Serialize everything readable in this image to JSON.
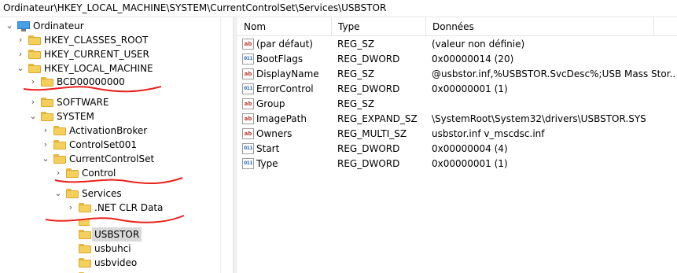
{
  "address_bar": {
    "path": "Ordinateur\\HKEY_LOCAL_MACHINE\\SYSTEM\\CurrentControlSet\\Services\\USBSTOR"
  },
  "tree": {
    "root": "Ordinateur",
    "nodes": [
      {
        "label": "HKEY_CLASSES_ROOT",
        "chevron": "›"
      },
      {
        "label": "HKEY_CURRENT_USER",
        "chevron": "›"
      },
      {
        "label": "HKEY_LOCAL_MACHINE",
        "chevron": "⌄"
      },
      {
        "label": "BCD00000000",
        "chevron": "›"
      },
      {
        "label": "SOFTWARE",
        "chevron": "›"
      },
      {
        "label": "SYSTEM",
        "chevron": "⌄"
      },
      {
        "label": "ActivationBroker",
        "chevron": "›"
      },
      {
        "label": "ControlSet001",
        "chevron": "›"
      },
      {
        "label": "CurrentControlSet",
        "chevron": "⌄"
      },
      {
        "label": "Control",
        "chevron": "›"
      },
      {
        "label": "Services",
        "chevron": "⌄"
      },
      {
        "label": ".NET CLR Data",
        "chevron": "›"
      },
      {
        "label": "USBSTOR",
        "chevron": ""
      },
      {
        "label": "usbuhci",
        "chevron": ""
      },
      {
        "label": "usbvideo",
        "chevron": ""
      }
    ],
    "root_chevron": "⌄"
  },
  "columns": {
    "name": "Nom",
    "type": "Type",
    "data": "Données"
  },
  "values": [
    {
      "icon": "ab",
      "name": "(par défaut)",
      "type": "REG_SZ",
      "data": "(valeur non définie)"
    },
    {
      "icon": "bin",
      "name": "BootFlags",
      "type": "REG_DWORD",
      "data": "0x00000014 (20)"
    },
    {
      "icon": "ab",
      "name": "DisplayName",
      "type": "REG_SZ",
      "data": "@usbstor.inf,%USBSTOR.SvcDesc%;USB Mass Stor..."
    },
    {
      "icon": "bin",
      "name": "ErrorControl",
      "type": "REG_DWORD",
      "data": "0x00000001 (1)"
    },
    {
      "icon": "ab",
      "name": "Group",
      "type": "REG_SZ",
      "data": ""
    },
    {
      "icon": "ab",
      "name": "ImagePath",
      "type": "REG_EXPAND_SZ",
      "data": "\\SystemRoot\\System32\\drivers\\USBSTOR.SYS"
    },
    {
      "icon": "ab",
      "name": "Owners",
      "type": "REG_MULTI_SZ",
      "data": "usbstor.inf v_mscdsc.inf"
    },
    {
      "icon": "bin",
      "name": "Start",
      "type": "REG_DWORD",
      "data": "0x00000004 (4)"
    },
    {
      "icon": "bin",
      "name": "Type",
      "type": "REG_DWORD",
      "data": "0x00000001 (1)"
    }
  ],
  "icon_labels": {
    "ab": "ab",
    "bin": "011"
  },
  "colors": {
    "annotation": "#e8231e",
    "folder": "#f5cf5c",
    "selection": "#d9d9d9"
  }
}
